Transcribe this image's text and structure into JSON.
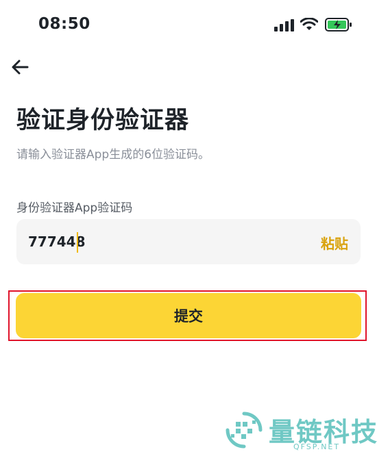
{
  "status_bar": {
    "time": "08:50"
  },
  "header": {
    "title": "验证身份验证器",
    "subtitle": "请输入验证器App生成的6位验证码。"
  },
  "form": {
    "field_label": "身份验证器App验证码",
    "code_value": "777448",
    "paste_label": "粘贴",
    "submit_label": "提交"
  },
  "watermark": {
    "text": "量链科技",
    "url": "QFSP.NET"
  },
  "colors": {
    "accent": "#fcd535",
    "paste_text": "#d9a20c",
    "highlight_border": "#e0142b",
    "battery_fill": "#34c759",
    "watermark": "#6fc8c4"
  },
  "icons": [
    "back-arrow-icon",
    "signal-icon",
    "wifi-icon",
    "battery-icon"
  ]
}
